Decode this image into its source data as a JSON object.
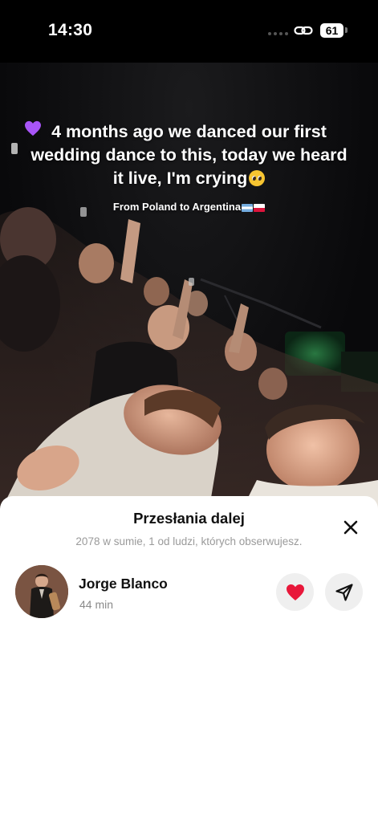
{
  "status_bar": {
    "time": "14:30",
    "battery": "61",
    "icons": [
      "signal-dots",
      "link-icon",
      "battery-icon"
    ]
  },
  "video": {
    "caption": "4 months ago we danced our first wedding dance to this, today we heard it live, I'm crying",
    "caption_emojis": [
      "pleading-face-icon",
      "purple-heart-icon"
    ],
    "subcaption": "From Poland to Argentina",
    "subcaption_flags": [
      "argentina-flag-icon",
      "poland-flag-icon"
    ]
  },
  "sheet": {
    "title": "Przesłania dalej",
    "subtitle": "2078 w sumie, 1 od ludzi, których obserwujesz.",
    "close_icon": "close-icon",
    "users": [
      {
        "name": "Jorge Blanco",
        "time": "44 min",
        "liked": true,
        "actions": [
          "heart-icon",
          "send-icon"
        ]
      }
    ]
  },
  "colors": {
    "heart": "#e8173a",
    "sheet_background": "#ffffff",
    "button_background": "#efefef",
    "subtitle_text": "#9a9a9a",
    "purple_heart": "#a855f7"
  }
}
